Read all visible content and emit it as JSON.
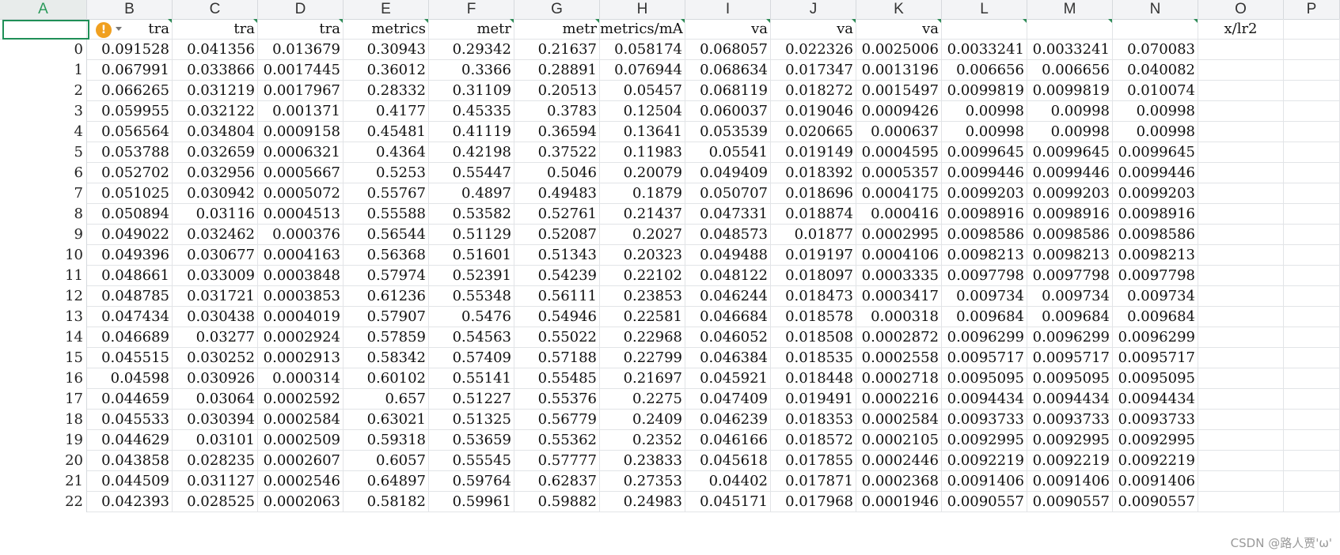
{
  "columns": [
    "A",
    "B",
    "C",
    "D",
    "E",
    "F",
    "G",
    "H",
    "I",
    "J",
    "K",
    "L",
    "M",
    "N",
    "O",
    "P"
  ],
  "header_cells": [
    "",
    "tra",
    "tra",
    "tra",
    "metrics",
    "metr",
    "metr",
    "metrics/mA",
    "va",
    "va",
    "va",
    "",
    "",
    "",
    "x/lr2",
    ""
  ],
  "row_indices": [
    "0",
    "1",
    "2",
    "3",
    "4",
    "5",
    "6",
    "7",
    "8",
    "9",
    "10",
    "11",
    "12",
    "13",
    "14",
    "15",
    "16",
    "17",
    "18",
    "19",
    "20",
    "21",
    "22"
  ],
  "rows": [
    [
      "0.091528",
      "0.041356",
      "0.013679",
      "0.30943",
      "0.29342",
      "0.21637",
      "0.058174",
      "0.068057",
      "0.022326",
      "0.0025006",
      "0.0033241",
      "0.0033241",
      "0.070083"
    ],
    [
      "0.067991",
      "0.033866",
      "0.0017445",
      "0.36012",
      "0.3366",
      "0.28891",
      "0.076944",
      "0.068634",
      "0.017347",
      "0.0013196",
      "0.006656",
      "0.006656",
      "0.040082"
    ],
    [
      "0.066265",
      "0.031219",
      "0.0017967",
      "0.28332",
      "0.31109",
      "0.20513",
      "0.05457",
      "0.068119",
      "0.018272",
      "0.0015497",
      "0.0099819",
      "0.0099819",
      "0.010074"
    ],
    [
      "0.059955",
      "0.032122",
      "0.001371",
      "0.4177",
      "0.45335",
      "0.3783",
      "0.12504",
      "0.060037",
      "0.019046",
      "0.0009426",
      "0.00998",
      "0.00998",
      "0.00998"
    ],
    [
      "0.056564",
      "0.034804",
      "0.0009158",
      "0.45481",
      "0.41119",
      "0.36594",
      "0.13641",
      "0.053539",
      "0.020665",
      "0.000637",
      "0.00998",
      "0.00998",
      "0.00998"
    ],
    [
      "0.053788",
      "0.032659",
      "0.0006321",
      "0.4364",
      "0.42198",
      "0.37522",
      "0.11983",
      "0.05541",
      "0.019149",
      "0.0004595",
      "0.0099645",
      "0.0099645",
      "0.0099645"
    ],
    [
      "0.052702",
      "0.032956",
      "0.0005667",
      "0.5253",
      "0.55447",
      "0.5046",
      "0.20079",
      "0.049409",
      "0.018392",
      "0.0005357",
      "0.0099446",
      "0.0099446",
      "0.0099446"
    ],
    [
      "0.051025",
      "0.030942",
      "0.0005072",
      "0.55767",
      "0.4897",
      "0.49483",
      "0.1879",
      "0.050707",
      "0.018696",
      "0.0004175",
      "0.0099203",
      "0.0099203",
      "0.0099203"
    ],
    [
      "0.050894",
      "0.03116",
      "0.0004513",
      "0.55588",
      "0.53582",
      "0.52761",
      "0.21437",
      "0.047331",
      "0.018874",
      "0.000416",
      "0.0098916",
      "0.0098916",
      "0.0098916"
    ],
    [
      "0.049022",
      "0.032462",
      "0.000376",
      "0.56544",
      "0.51129",
      "0.52087",
      "0.2027",
      "0.048573",
      "0.01877",
      "0.0002995",
      "0.0098586",
      "0.0098586",
      "0.0098586"
    ],
    [
      "0.049396",
      "0.030677",
      "0.0004163",
      "0.56368",
      "0.51601",
      "0.51343",
      "0.20323",
      "0.049488",
      "0.019197",
      "0.0004106",
      "0.0098213",
      "0.0098213",
      "0.0098213"
    ],
    [
      "0.048661",
      "0.033009",
      "0.0003848",
      "0.57974",
      "0.52391",
      "0.54239",
      "0.22102",
      "0.048122",
      "0.018097",
      "0.0003335",
      "0.0097798",
      "0.0097798",
      "0.0097798"
    ],
    [
      "0.048785",
      "0.031721",
      "0.0003853",
      "0.61236",
      "0.55348",
      "0.56111",
      "0.23853",
      "0.046244",
      "0.018473",
      "0.0003417",
      "0.009734",
      "0.009734",
      "0.009734"
    ],
    [
      "0.047434",
      "0.030438",
      "0.0004019",
      "0.57907",
      "0.5476",
      "0.54946",
      "0.22581",
      "0.046684",
      "0.018578",
      "0.000318",
      "0.009684",
      "0.009684",
      "0.009684"
    ],
    [
      "0.046689",
      "0.03277",
      "0.0002924",
      "0.57859",
      "0.54563",
      "0.55022",
      "0.22968",
      "0.046052",
      "0.018508",
      "0.0002872",
      "0.0096299",
      "0.0096299",
      "0.0096299"
    ],
    [
      "0.045515",
      "0.030252",
      "0.0002913",
      "0.58342",
      "0.57409",
      "0.57188",
      "0.22799",
      "0.046384",
      "0.018535",
      "0.0002558",
      "0.0095717",
      "0.0095717",
      "0.0095717"
    ],
    [
      "0.04598",
      "0.030926",
      "0.000314",
      "0.60102",
      "0.55141",
      "0.55485",
      "0.21697",
      "0.045921",
      "0.018448",
      "0.0002718",
      "0.0095095",
      "0.0095095",
      "0.0095095"
    ],
    [
      "0.044659",
      "0.03064",
      "0.0002592",
      "0.657",
      "0.51227",
      "0.55376",
      "0.2275",
      "0.047409",
      "0.019491",
      "0.0002216",
      "0.0094434",
      "0.0094434",
      "0.0094434"
    ],
    [
      "0.045533",
      "0.030394",
      "0.0002584",
      "0.63021",
      "0.51325",
      "0.56779",
      "0.2409",
      "0.046239",
      "0.018353",
      "0.0002584",
      "0.0093733",
      "0.0093733",
      "0.0093733"
    ],
    [
      "0.044629",
      "0.03101",
      "0.0002509",
      "0.59318",
      "0.53659",
      "0.55362",
      "0.2352",
      "0.046166",
      "0.018572",
      "0.0002105",
      "0.0092995",
      "0.0092995",
      "0.0092995"
    ],
    [
      "0.043858",
      "0.028235",
      "0.0002607",
      "0.6057",
      "0.55545",
      "0.57777",
      "0.23833",
      "0.045618",
      "0.017855",
      "0.0002446",
      "0.0092219",
      "0.0092219",
      "0.0092219"
    ],
    [
      "0.044509",
      "0.031127",
      "0.0002546",
      "0.64897",
      "0.59764",
      "0.62837",
      "0.27353",
      "0.04402",
      "0.017871",
      "0.0002368",
      "0.0091406",
      "0.0091406",
      "0.0091406"
    ],
    [
      "0.042393",
      "0.028525",
      "0.0002063",
      "0.58182",
      "0.59961",
      "0.59882",
      "0.24983",
      "0.045171",
      "0.017968",
      "0.0001946",
      "0.0090557",
      "0.0090557",
      "0.0090557"
    ]
  ],
  "warning_icon": "!",
  "watermark": "CSDN @路人贾'ω'"
}
